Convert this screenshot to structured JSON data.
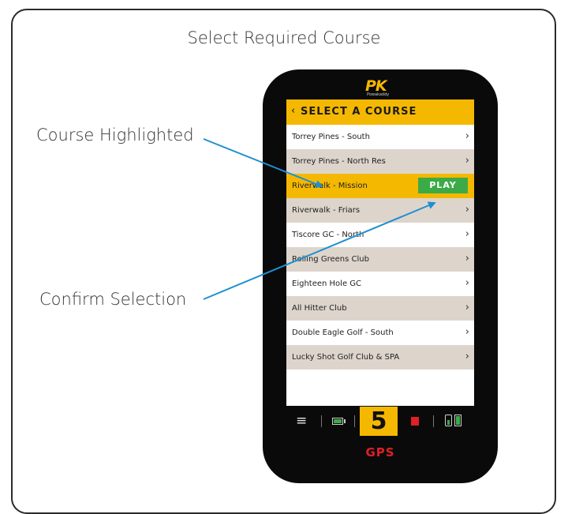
{
  "title": "Select Required Course",
  "callouts": {
    "highlighted": "Course Highlighted",
    "confirm": "Confirm Selection"
  },
  "device": {
    "logo_text": "PK",
    "logo_sub": "Powakaddy",
    "header": {
      "back_icon": "chevron-left-icon",
      "back_glyph": "‹",
      "title": "SELECT A COURSE"
    },
    "courses": [
      {
        "label": "Torrey Pines - South",
        "chevron": "›",
        "style": "white"
      },
      {
        "label": "Torrey Pines - North Res",
        "chevron": "›",
        "style": "tan"
      },
      {
        "label": "Riverwalk - Mission",
        "chevron": "",
        "style": "selected",
        "action": "PLAY"
      },
      {
        "label": "Riverwalk - Friars",
        "chevron": "›",
        "style": "tan"
      },
      {
        "label": "Tiscore GC - North",
        "chevron": "›",
        "style": "white"
      },
      {
        "label": "Rolling Greens Club",
        "chevron": "›",
        "style": "tan"
      },
      {
        "label": "Eighteen Hole GC",
        "chevron": "›",
        "style": "white"
      },
      {
        "label": "All Hitter Club",
        "chevron": "›",
        "style": "tan"
      },
      {
        "label": "Double Eagle Golf - South",
        "chevron": "›",
        "style": "white"
      },
      {
        "label": "Lucky Shot Golf Club & SPA",
        "chevron": "›",
        "style": "tan"
      }
    ],
    "bottom_bar": {
      "menu_glyph": "≡",
      "speed_value": "5"
    },
    "gps_label": "GPS"
  },
  "colors": {
    "accent": "#f5b800",
    "play_green": "#3cab47",
    "row_tan": "#ddd5cc",
    "gps_red": "#e01f26",
    "arrow_blue": "#1f8fd0"
  }
}
